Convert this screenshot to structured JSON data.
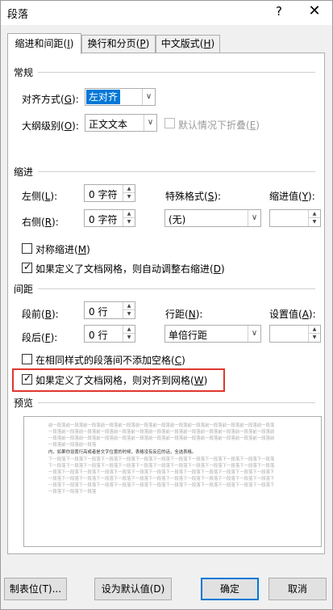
{
  "window": {
    "title": "段落",
    "help": "?",
    "close": "✕"
  },
  "tabs": [
    {
      "label": "缩进和间距",
      "key": "I"
    },
    {
      "label": "换行和分页",
      "key": "P"
    },
    {
      "label": "中文版式",
      "key": "H"
    }
  ],
  "general": {
    "heading": "常规",
    "alignment_label": "对齐方式",
    "alignment_key": "G",
    "alignment_value": "左对齐",
    "outline_label": "大纲级别",
    "outline_key": "O",
    "outline_value": "正文文本",
    "collapse_label": "默认情况下折叠",
    "collapse_key": "E"
  },
  "indent": {
    "heading": "缩进",
    "left_label": "左侧",
    "left_key": "L",
    "left_value": "0 字符",
    "right_label": "右侧",
    "right_key": "R",
    "right_value": "0 字符",
    "special_label": "特殊格式",
    "special_key": "S",
    "special_value": "(无)",
    "amount_label": "缩进值",
    "amount_key": "Y",
    "amount_value": "",
    "mirror_label": "对称缩进",
    "mirror_key": "M",
    "autoadjust_label": "如果定义了文档网格，则自动调整右缩进",
    "autoadjust_key": "D"
  },
  "spacing": {
    "heading": "间距",
    "before_label": "段前",
    "before_key": "B",
    "before_value": "0 行",
    "after_label": "段后",
    "after_key": "F",
    "after_value": "0 行",
    "line_label": "行距",
    "line_key": "N",
    "line_value": "单倍行距",
    "at_label": "设置值",
    "at_key": "A",
    "at_value": "",
    "nospace_label": "在相同样式的段落间不添加空格",
    "nospace_key": "C",
    "snap_label": "如果定义了文档网格，则对齐到网格",
    "snap_key": "W"
  },
  "preview": {
    "heading": "预览",
    "lines": [
      "前一段落前一段落前一段落前一段落前一段落前一段落前一段落前一段落前一段落前一段落前一段落前一段落前一段落",
      "一段落前一段落前一段落前一段落前一段落前一段落前一段落前一段落前一段落前一段落前一段落前一段落前一段落前",
      "一段落前一段落前一段落前一段落前一段落前一段落前一段落前一段落前一段落前一段落前一段落前一段落前一段落前",
      "一段落前一段落前一段落",
      "内，如果你设置行高或者是文字位置的时候，表格没有反应的话，全选表格。",
      "下一段落下一段落下一段落下一段落下一段落下一段落下一段落下一段落下一段落下一段落下一段落下一段落下一段落",
      "下一段落下一段落下一段落下一段落下一段落下一段落下一段落下一段落下一段落下一段落下一段落下一段落下一段落",
      "一段落下一段落下一段落下一段落下一段落下一段落下一段落下一段落下一段落下一段落下一段落下一段落下一段落下",
      "一段落下一段落下一段落下一段落下一段落下一段落下一段落下一段落下一段落下一段落下一段落下一段落下一段落下",
      "一段落下一段落下一段落下一段落下一段落下一段落下一段落下一段落下一段落下一段落下一段落下一段落下一段落下",
      "一段落下一段落下一段落"
    ]
  },
  "buttons": {
    "tabs_label": "制表位(T)...",
    "default_label": "设为默认值(D)",
    "ok_label": "确定",
    "cancel_label": "取消"
  },
  "colors": {
    "accent": "#0078d7",
    "highlight": "#e0372f"
  }
}
